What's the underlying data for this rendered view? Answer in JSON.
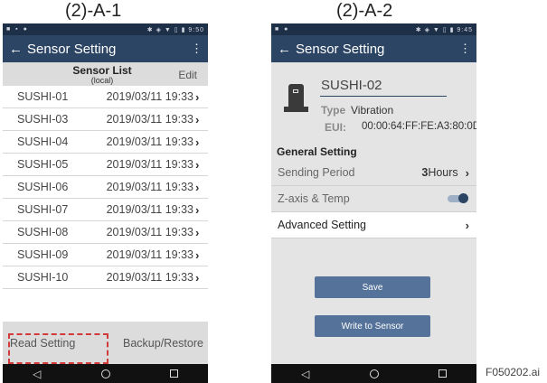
{
  "figure_captions": [
    "(2)-A-1",
    "(2)-A-2"
  ],
  "figure_id": "F050202.ai",
  "screen1": {
    "status_time": "9:50",
    "app_title": "Sensor Setting",
    "list_title": "Sensor List",
    "list_subtitle": "(local)",
    "edit_label": "Edit",
    "sensors": [
      {
        "name": "SUSHI-01",
        "date": "2019/03/11",
        "time": "19:33"
      },
      {
        "name": "SUSHI-03",
        "date": "2019/03/11",
        "time": "19:33"
      },
      {
        "name": "SUSHI-04",
        "date": "2019/03/11",
        "time": "19:33"
      },
      {
        "name": "SUSHI-05",
        "date": "2019/03/11",
        "time": "19:33"
      },
      {
        "name": "SUSHI-06",
        "date": "2019/03/11",
        "time": "19:33"
      },
      {
        "name": "SUSHI-07",
        "date": "2019/03/11",
        "time": "19:33"
      },
      {
        "name": "SUSHI-08",
        "date": "2019/03/11",
        "time": "19:33"
      },
      {
        "name": "SUSHI-09",
        "date": "2019/03/11",
        "time": "19:33"
      },
      {
        "name": "SUSHI-10",
        "date": "2019/03/11",
        "time": "19:33"
      }
    ],
    "read_setting_label": "Read Setting",
    "backup_restore_label": "Backup/Restore"
  },
  "screen2": {
    "status_time": "9:45",
    "app_title": "Sensor Setting",
    "device_name": "SUSHI-02",
    "type_label": "Type",
    "type_value": "Vibration",
    "eui_label": "EUI:",
    "eui_value": "00:00:64:FF:FE:A3:80:0D",
    "general_setting_title": "General Setting",
    "sending_period_label": "Sending Period",
    "sending_period_number": "3",
    "sending_period_unit": "Hours",
    "zaxis_label": "Z-axis & Temp",
    "zaxis_enabled": true,
    "advanced_setting_label": "Advanced Setting",
    "save_label": "Save",
    "write_label": "Write to Sensor"
  },
  "colors": {
    "appbar": "#2c4564",
    "statusbar": "#1e2f48",
    "button": "#55739a",
    "highlight_dash": "#d23a3a"
  },
  "icons": {
    "back": "arrow-left-icon",
    "menu": "overflow-menu-icon",
    "chevron": "chevron-right-icon",
    "nav_back": "nav-back-icon",
    "nav_home": "nav-home-icon",
    "nav_recent": "nav-recent-icon",
    "device": "sensor-device-icon"
  }
}
